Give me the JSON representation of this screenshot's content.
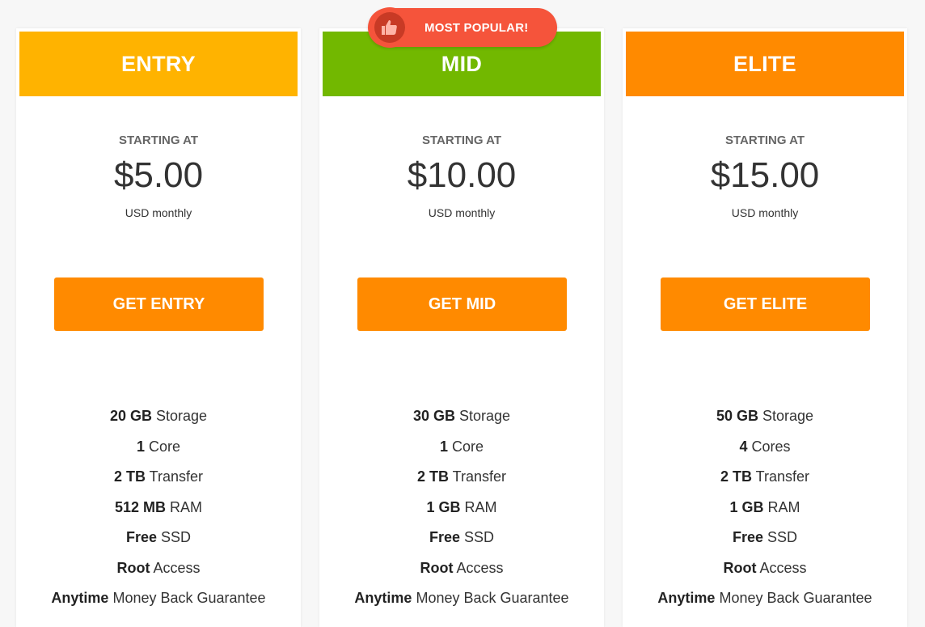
{
  "colors": {
    "page_bg": "#f7f7f7",
    "entry_header": "#ffb300",
    "mid_header": "#72b800",
    "elite_header": "#ff8a00",
    "button": "#ff8a00",
    "badge": "#f5543b",
    "badge_dark": "#c83a25"
  },
  "badge": {
    "label": "MOST POPULAR!",
    "icon": "thumbs-up-icon"
  },
  "plans": [
    {
      "name": "ENTRY",
      "starting_label": "STARTING AT",
      "price": "$5.00",
      "period": "USD monthly",
      "button_label": "GET ENTRY",
      "features": [
        {
          "bold": "20 GB",
          "text": "Storage"
        },
        {
          "bold": "1",
          "text": "Core"
        },
        {
          "bold": "2 TB",
          "text": "Transfer"
        },
        {
          "bold": "512 MB",
          "text": "RAM"
        },
        {
          "bold": "Free",
          "text": "SSD"
        },
        {
          "bold": "Root",
          "text": "Access"
        },
        {
          "bold": "Anytime",
          "text": "Money Back Guarantee"
        }
      ]
    },
    {
      "name": "MID",
      "starting_label": "STARTING AT",
      "price": "$10.00",
      "period": "USD monthly",
      "button_label": "GET MID",
      "features": [
        {
          "bold": "30 GB",
          "text": "Storage"
        },
        {
          "bold": "1",
          "text": "Core"
        },
        {
          "bold": "2 TB",
          "text": "Transfer"
        },
        {
          "bold": "1 GB",
          "text": "RAM"
        },
        {
          "bold": "Free",
          "text": "SSD"
        },
        {
          "bold": "Root",
          "text": "Access"
        },
        {
          "bold": "Anytime",
          "text": "Money Back Guarantee"
        }
      ]
    },
    {
      "name": "ELITE",
      "starting_label": "STARTING AT",
      "price": "$15.00",
      "period": "USD monthly",
      "button_label": "GET ELITE",
      "features": [
        {
          "bold": "50 GB",
          "text": "Storage"
        },
        {
          "bold": "4",
          "text": "Cores"
        },
        {
          "bold": "2 TB",
          "text": "Transfer"
        },
        {
          "bold": "1 GB",
          "text": "RAM"
        },
        {
          "bold": "Free",
          "text": "SSD"
        },
        {
          "bold": "Root",
          "text": "Access"
        },
        {
          "bold": "Anytime",
          "text": "Money Back Guarantee"
        }
      ]
    }
  ]
}
